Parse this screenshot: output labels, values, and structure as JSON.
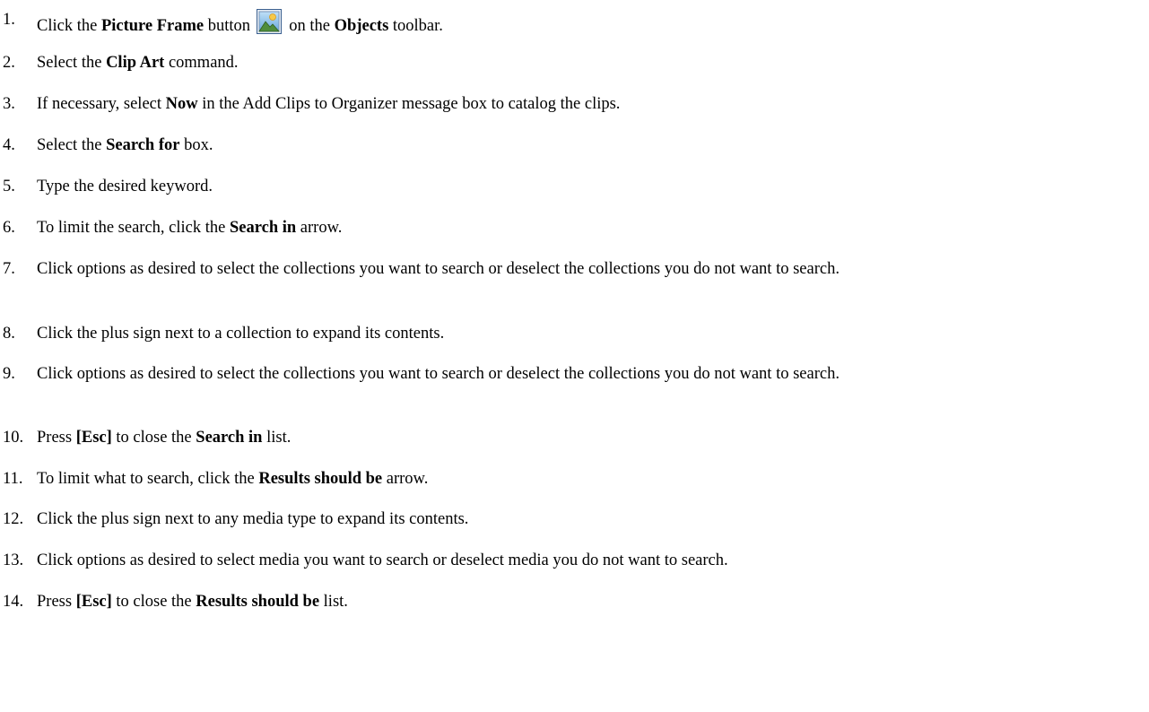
{
  "steps": [
    {
      "num": "1.",
      "parts": [
        {
          "t": "Click the "
        },
        {
          "t": "Picture Frame",
          "b": true
        },
        {
          "t": " button "
        },
        {
          "icon": "picture-frame-icon"
        },
        {
          "t": " on the "
        },
        {
          "t": "Objects",
          "b": true
        },
        {
          "t": " toolbar."
        }
      ]
    },
    {
      "num": "2.",
      "parts": [
        {
          "t": "Select the "
        },
        {
          "t": "Clip Art",
          "b": true
        },
        {
          "t": " command."
        }
      ]
    },
    {
      "num": "3.",
      "parts": [
        {
          "t": "If necessary, select "
        },
        {
          "t": "Now",
          "b": true
        },
        {
          "t": " in the Add Clips to Organizer message box to catalog the clips."
        }
      ]
    },
    {
      "num": "4.",
      "parts": [
        {
          "t": "Select the "
        },
        {
          "t": "Search for",
          "b": true
        },
        {
          "t": " box."
        }
      ]
    },
    {
      "num": "5.",
      "parts": [
        {
          "t": "Type the desired keyword."
        }
      ]
    },
    {
      "num": "6.",
      "parts": [
        {
          "t": "To limit the search, click the "
        },
        {
          "t": "Search in",
          "b": true
        },
        {
          "t": " arrow."
        }
      ]
    },
    {
      "num": "7.",
      "parts": [
        {
          "t": "Click options as desired to select the collections you want to search or deselect the collections you do not want to search."
        }
      ]
    },
    {
      "num": "8.",
      "parts": [
        {
          "t": "Click the plus sign next to a collection to expand its contents."
        }
      ]
    },
    {
      "num": "9.",
      "parts": [
        {
          "t": "Click options as desired to select the collections you want to search or deselect the collections you do not want to search."
        }
      ]
    },
    {
      "num": "10.",
      "parts": [
        {
          "t": "Press "
        },
        {
          "t": "[Esc]",
          "b": true
        },
        {
          "t": " to close the "
        },
        {
          "t": "Search in",
          "b": true
        },
        {
          "t": " list."
        }
      ]
    },
    {
      "num": "11.",
      "parts": [
        {
          "t": "To limit what to search, click the "
        },
        {
          "t": "Results should be",
          "b": true
        },
        {
          "t": " arrow."
        }
      ]
    },
    {
      "num": "12.",
      "parts": [
        {
          "t": "Click the plus sign next to any media type to expand its contents."
        }
      ]
    },
    {
      "num": "13.",
      "parts": [
        {
          "t": "Click options as desired to select media you want to search or deselect media you do not want to search."
        }
      ]
    },
    {
      "num": "14.",
      "parts": [
        {
          "t": "Press "
        },
        {
          "t": "[Esc]",
          "b": true
        },
        {
          "t": " to close the "
        },
        {
          "t": "Results should be",
          "b": true
        },
        {
          "t": " list."
        }
      ]
    }
  ]
}
